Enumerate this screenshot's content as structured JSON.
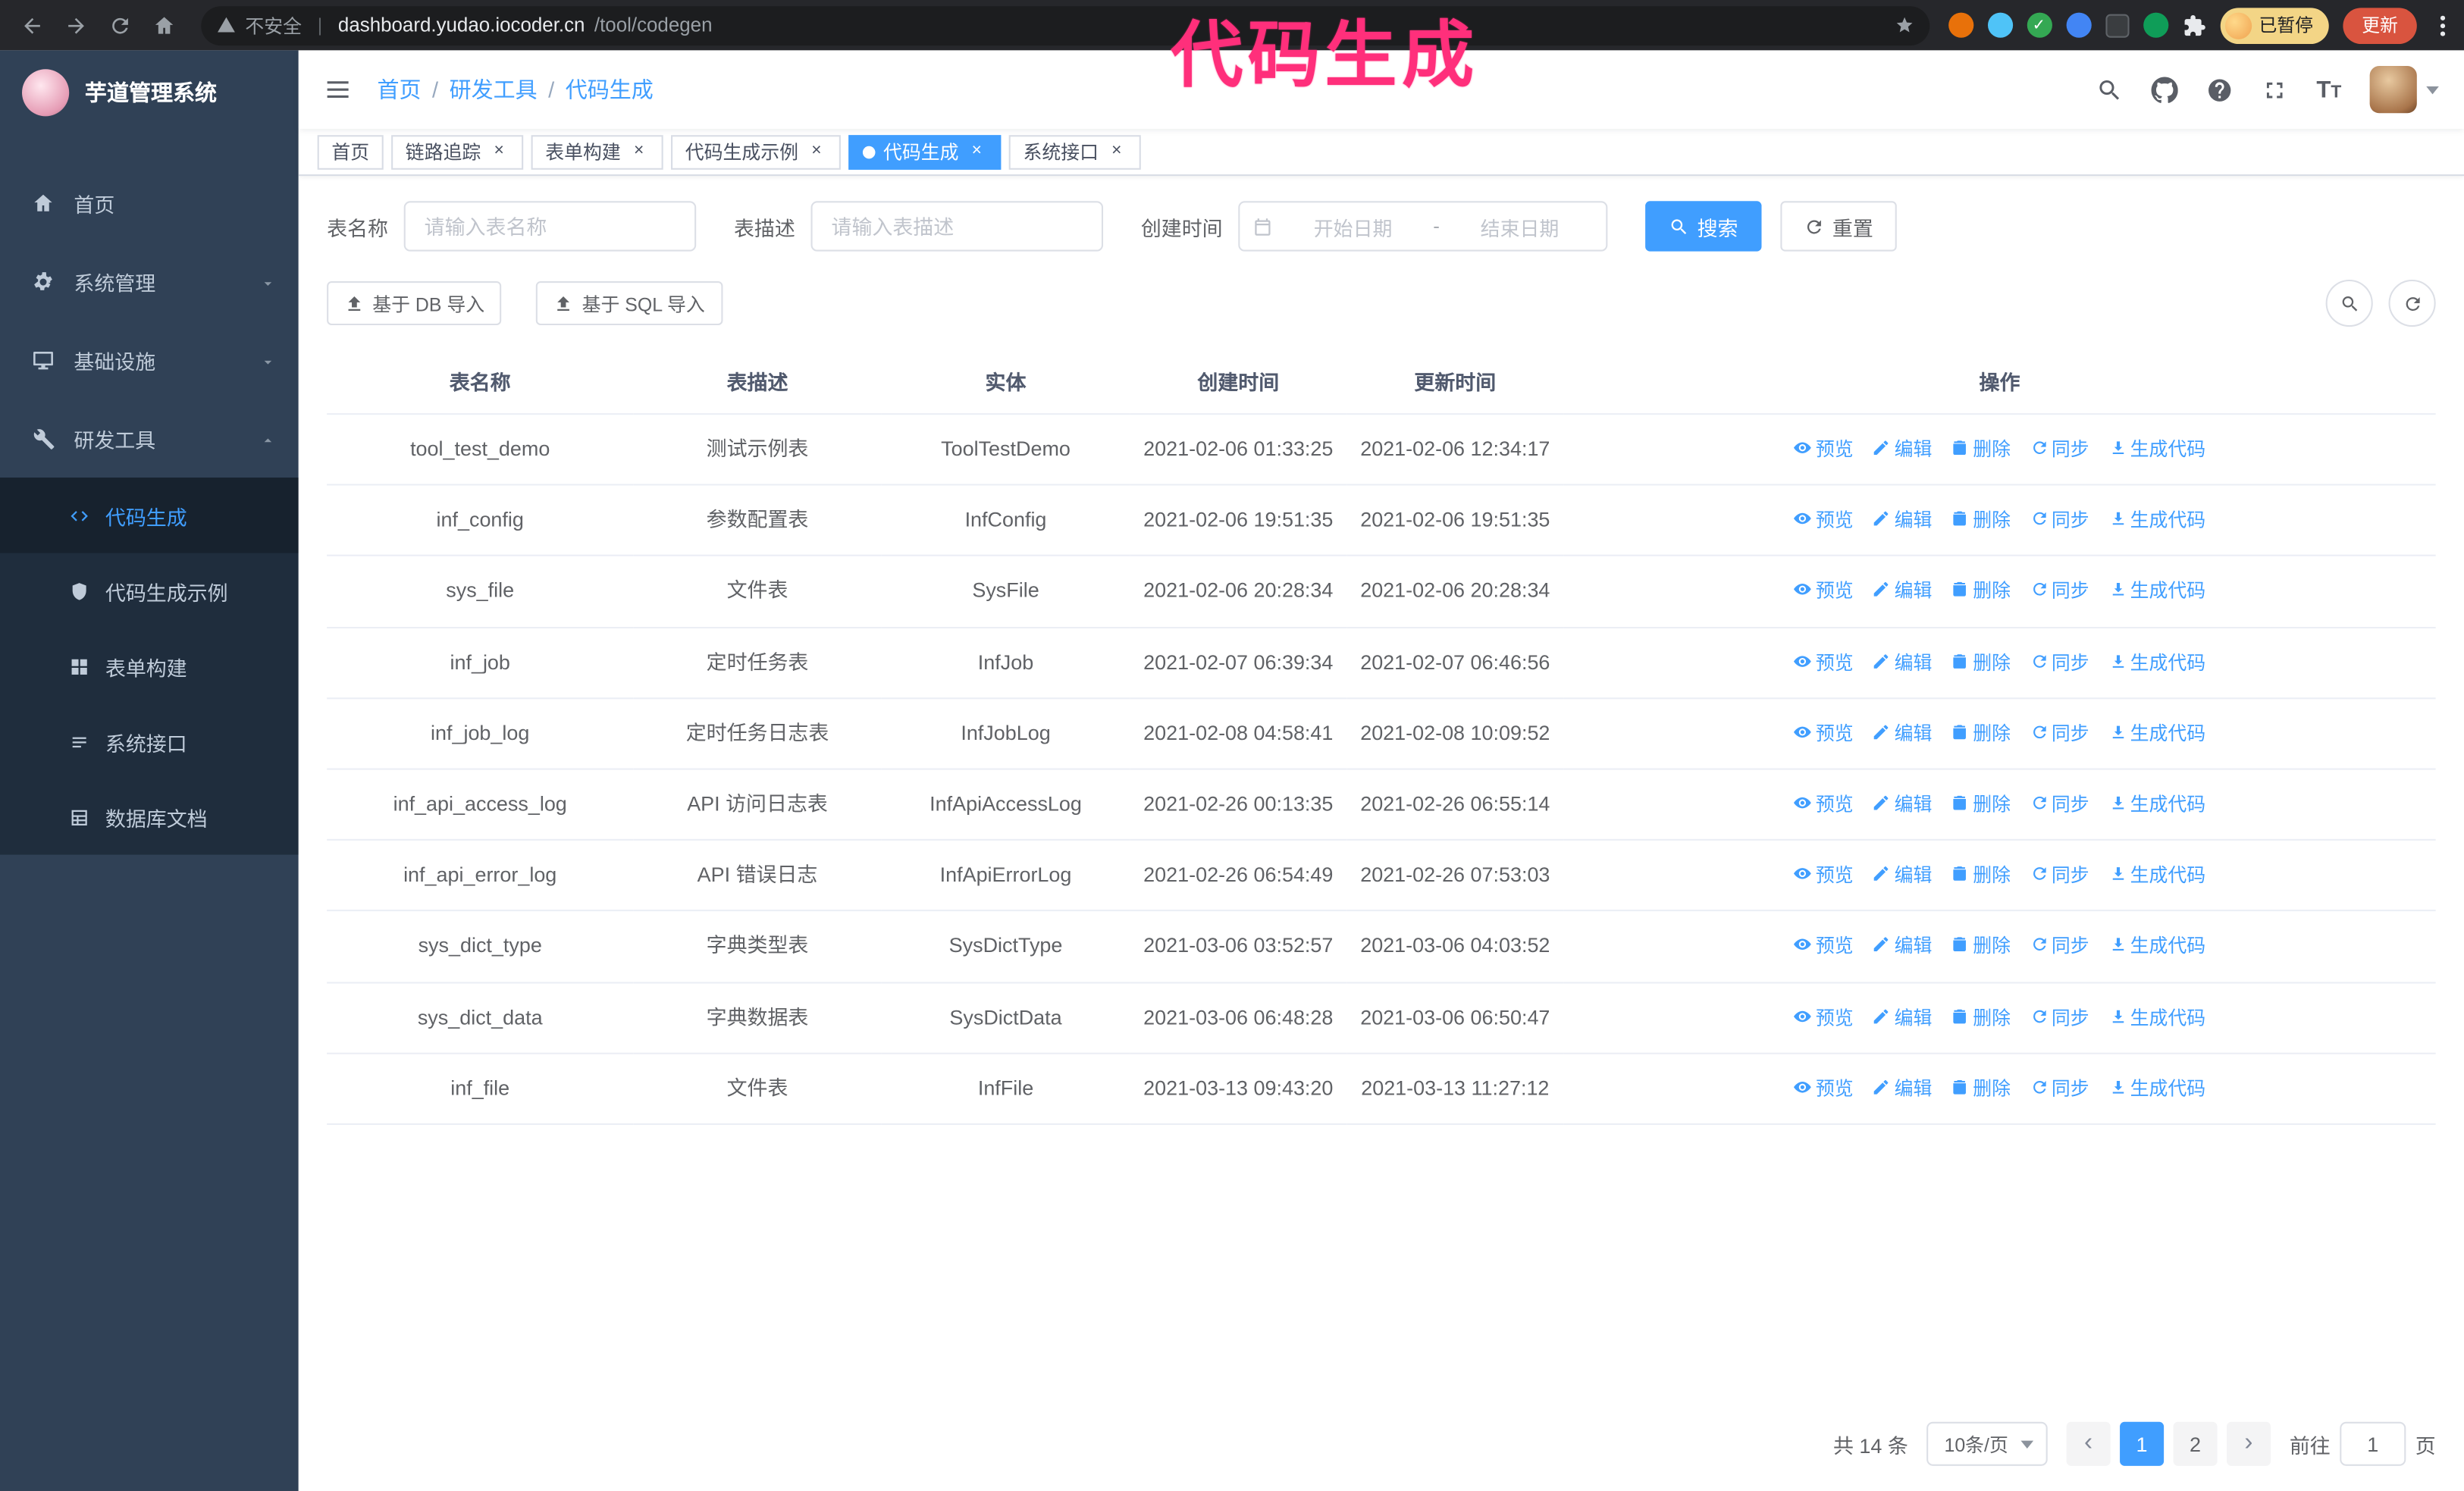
{
  "colors": {
    "accent": "#409eff",
    "sidebar_bg": "#304156",
    "submenu_bg": "#1f2d3d",
    "annotation_pink": "#ff2f7b",
    "update_button": "#d9543f"
  },
  "browser": {
    "security_warning": "不安全",
    "url_domain": "dashboard.yudao.iocoder.cn",
    "url_path": "/tool/codegen",
    "paused_badge": "已暂停",
    "update_button": "更新"
  },
  "overlay": {
    "annotation": "代码生成"
  },
  "sidebar": {
    "logo_title": "芋道管理系统",
    "items": [
      {
        "label": "首页"
      },
      {
        "label": "系统管理"
      },
      {
        "label": "基础设施"
      },
      {
        "label": "研发工具"
      }
    ],
    "submenu": [
      {
        "label": "代码生成"
      },
      {
        "label": "代码生成示例"
      },
      {
        "label": "表单构建"
      },
      {
        "label": "系统接口"
      },
      {
        "label": "数据库文档"
      }
    ]
  },
  "header": {
    "breadcrumb": [
      "首页",
      "研发工具",
      "代码生成"
    ]
  },
  "tabs": [
    {
      "label": "首页"
    },
    {
      "label": "链路追踪"
    },
    {
      "label": "表单构建"
    },
    {
      "label": "代码生成示例"
    },
    {
      "label": "代码生成"
    },
    {
      "label": "系统接口"
    }
  ],
  "filters": {
    "table_name_label": "表名称",
    "table_name_placeholder": "请输入表名称",
    "table_desc_label": "表描述",
    "table_desc_placeholder": "请输入表描述",
    "create_time_label": "创建时间",
    "start_placeholder": "开始日期",
    "range_separator": "-",
    "end_placeholder": "结束日期",
    "search_button": "搜索",
    "reset_button": "重置"
  },
  "toolbar": {
    "import_db": "基于 DB 导入",
    "import_sql": "基于 SQL 导入"
  },
  "table": {
    "columns": [
      "表名称",
      "表描述",
      "实体",
      "创建时间",
      "更新时间",
      "操作"
    ],
    "actions": [
      "预览",
      "编辑",
      "删除",
      "同步",
      "生成代码"
    ],
    "rows": [
      {
        "name": "tool_test_demo",
        "desc": "测试示例表",
        "entity": "ToolTestDemo",
        "created": "2021-02-06 01:33:25",
        "updated": "2021-02-06 12:34:17"
      },
      {
        "name": "inf_config",
        "desc": "参数配置表",
        "entity": "InfConfig",
        "created": "2021-02-06 19:51:35",
        "updated": "2021-02-06 19:51:35"
      },
      {
        "name": "sys_file",
        "desc": "文件表",
        "entity": "SysFile",
        "created": "2021-02-06 20:28:34",
        "updated": "2021-02-06 20:28:34"
      },
      {
        "name": "inf_job",
        "desc": "定时任务表",
        "entity": "InfJob",
        "created": "2021-02-07 06:39:34",
        "updated": "2021-02-07 06:46:56"
      },
      {
        "name": "inf_job_log",
        "desc": "定时任务日志表",
        "entity": "InfJobLog",
        "created": "2021-02-08 04:58:41",
        "updated": "2021-02-08 10:09:52"
      },
      {
        "name": "inf_api_access_log",
        "desc": "API 访问日志表",
        "entity": "InfApiAccessLog",
        "created": "2021-02-26 00:13:35",
        "updated": "2021-02-26 06:55:14"
      },
      {
        "name": "inf_api_error_log",
        "desc": "API 错误日志",
        "entity": "InfApiErrorLog",
        "created": "2021-02-26 06:54:49",
        "updated": "2021-02-26 07:53:03"
      },
      {
        "name": "sys_dict_type",
        "desc": "字典类型表",
        "entity": "SysDictType",
        "created": "2021-03-06 03:52:57",
        "updated": "2021-03-06 04:03:52"
      },
      {
        "name": "sys_dict_data",
        "desc": "字典数据表",
        "entity": "SysDictData",
        "created": "2021-03-06 06:48:28",
        "updated": "2021-03-06 06:50:47"
      },
      {
        "name": "inf_file",
        "desc": "文件表",
        "entity": "InfFile",
        "created": "2021-03-13 09:43:20",
        "updated": "2021-03-13 11:27:12"
      }
    ]
  },
  "pagination": {
    "total_label": "共 14 条",
    "page_size": "10条/页",
    "pages": [
      "1",
      "2"
    ],
    "goto_label": "前往",
    "goto_value": "1",
    "goto_unit": "页"
  }
}
